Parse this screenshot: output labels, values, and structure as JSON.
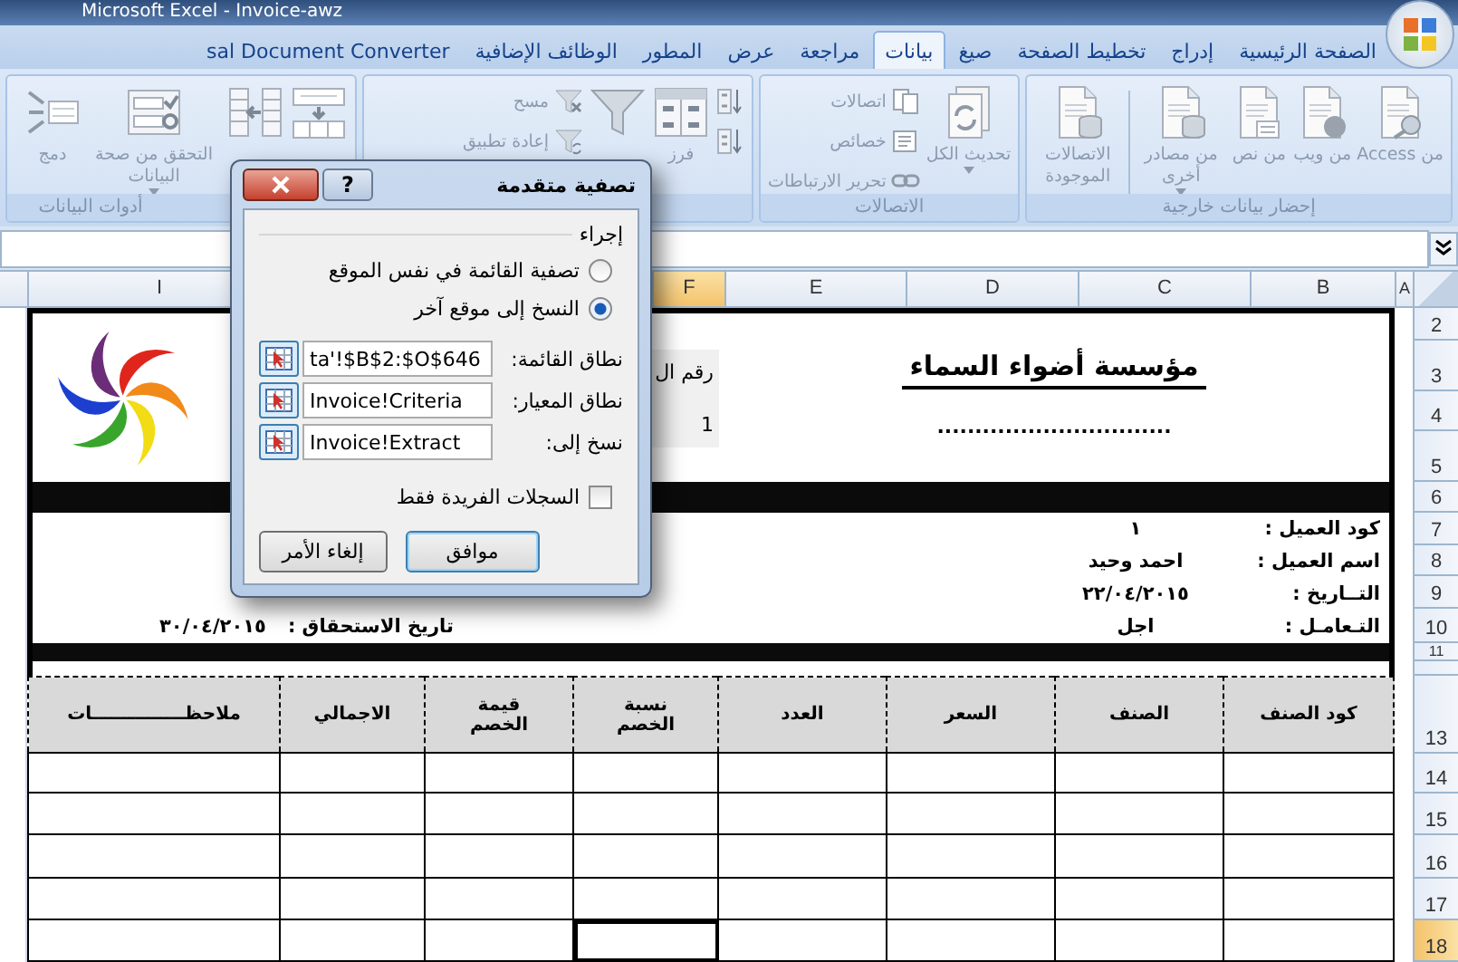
{
  "window": {
    "title": "Microsoft Excel - Invoice-awz"
  },
  "tabs": [
    {
      "label": "الصفحة الرئيسية",
      "selected": false
    },
    {
      "label": "إدراج",
      "selected": false
    },
    {
      "label": "تخطيط الصفحة",
      "selected": false
    },
    {
      "label": "صيغ",
      "selected": false
    },
    {
      "label": "بيانات",
      "selected": true
    },
    {
      "label": "مراجعة",
      "selected": false
    },
    {
      "label": "عرض",
      "selected": false
    },
    {
      "label": "المطور",
      "selected": false
    },
    {
      "label": "الوظائف الإضافية",
      "selected": false
    },
    {
      "label": "sal Document Converter",
      "selected": false
    }
  ],
  "ribbon": {
    "disabled": true,
    "groups": [
      {
        "label": "إحضار بيانات خارجية",
        "items": [
          {
            "kind": "large",
            "label": "من Access",
            "dropdown": false
          },
          {
            "kind": "large",
            "label": "من ويب",
            "dropdown": false
          },
          {
            "kind": "large",
            "label": "من نص",
            "dropdown": false
          },
          {
            "kind": "large",
            "label": "من مصادر أخرى",
            "dropdown": true
          },
          {
            "kind": "separator"
          },
          {
            "kind": "large",
            "label": "الاتصالات الموجودة",
            "dropdown": false
          }
        ]
      },
      {
        "label": "الاتصالات",
        "items": [
          {
            "kind": "large",
            "label": "تحديث الكل",
            "dropdown": true
          },
          {
            "kind": "stack",
            "buttons": [
              {
                "label": "اتصالات"
              },
              {
                "label": "خصائص"
              },
              {
                "label": "تحرير الارتباطات"
              }
            ]
          }
        ]
      },
      {
        "items": [
          {
            "kind": "sort-buttons"
          },
          {
            "kind": "large",
            "label": "فرز",
            "dropdown": false
          },
          {
            "kind": "large",
            "dropdown": false
          },
          {
            "kind": "stack",
            "buttons": [
              {
                "label": "مسح"
              },
              {
                "label": "إعادة تطبيق"
              }
            ]
          }
        ]
      },
      {
        "label": "أدوات البيانات",
        "items": [
          {
            "kind": "large",
            "dropdown": false
          },
          {
            "kind": "large",
            "dropdown": false
          },
          {
            "kind": "large",
            "label": "التحقق من صحة البيانات",
            "dropdown": true
          },
          {
            "kind": "large",
            "label": "دمج",
            "dropdown": false
          }
        ]
      }
    ]
  },
  "sheet": {
    "columns": [
      {
        "label": "A",
        "selected": false
      },
      {
        "label": "B",
        "selected": false
      },
      {
        "label": "C",
        "selected": false
      },
      {
        "label": "D",
        "selected": false
      },
      {
        "label": "E",
        "selected": false
      },
      {
        "label": "F",
        "selected": true
      },
      {
        "label": "I",
        "selected": false
      }
    ],
    "rows": [
      {
        "label": "2",
        "selected": false
      },
      {
        "label": "3",
        "selected": false
      },
      {
        "label": "4",
        "selected": false
      },
      {
        "label": "5",
        "selected": false
      },
      {
        "label": "6",
        "selected": false
      },
      {
        "label": "7",
        "selected": false
      },
      {
        "label": "8",
        "selected": false
      },
      {
        "label": "9",
        "selected": false
      },
      {
        "label": "10",
        "selected": false
      },
      {
        "label": "11",
        "selected": false
      },
      {
        "label": "13",
        "selected": false
      },
      {
        "label": "14",
        "selected": false
      },
      {
        "label": "15",
        "selected": false
      },
      {
        "label": "16",
        "selected": false
      },
      {
        "label": "17",
        "selected": false
      },
      {
        "label": "18",
        "selected": true
      }
    ],
    "invoice": {
      "company": "مؤسسة أضواء السماء",
      "dots": "...............................",
      "number_label": "رقم ال",
      "number": "1",
      "fields": [
        {
          "label": "كود العميل :",
          "value": "١"
        },
        {
          "label": "اسم العميل :",
          "value": "احمد وحيد"
        },
        {
          "label": "التــاريخ :",
          "value": "٢٢/٠٤/٢٠١٥"
        },
        {
          "label": "التـعامـل :",
          "value": "اجل"
        }
      ],
      "due_label": "تاريخ الاستحقاق :",
      "due_date": "٣٠/٠٤/٢٠١٥",
      "table_columns": [
        "كود الصنف",
        "الصنف",
        "السعر",
        "العدد",
        "نسبة الخصم",
        "قيمة الخصم",
        "الاجمالي",
        "ملاحظـــــــــــــــات"
      ]
    }
  },
  "dialog": {
    "title": "تصفية متقدمة",
    "help": "?",
    "action_label": "إجراء",
    "options": [
      {
        "label": "تصفية القائمة في نفس الموقع",
        "selected": false
      },
      {
        "label": "النسخ إلى موقع آخر",
        "selected": true
      }
    ],
    "fields": [
      {
        "label": "نطاق القائمة:",
        "value": "ta'!$B$2:$O$646"
      },
      {
        "label": "نطاق المعيار:",
        "value": "Invoice!Criteria"
      },
      {
        "label": "نسخ إلى:",
        "value": "Invoice!Extract"
      }
    ],
    "unique_only": {
      "label": "السجلات الفريدة فقط",
      "checked": false
    },
    "buttons": [
      {
        "label": "موافق",
        "default": true
      },
      {
        "label": "إلغاء الأمر",
        "default": false
      }
    ]
  }
}
